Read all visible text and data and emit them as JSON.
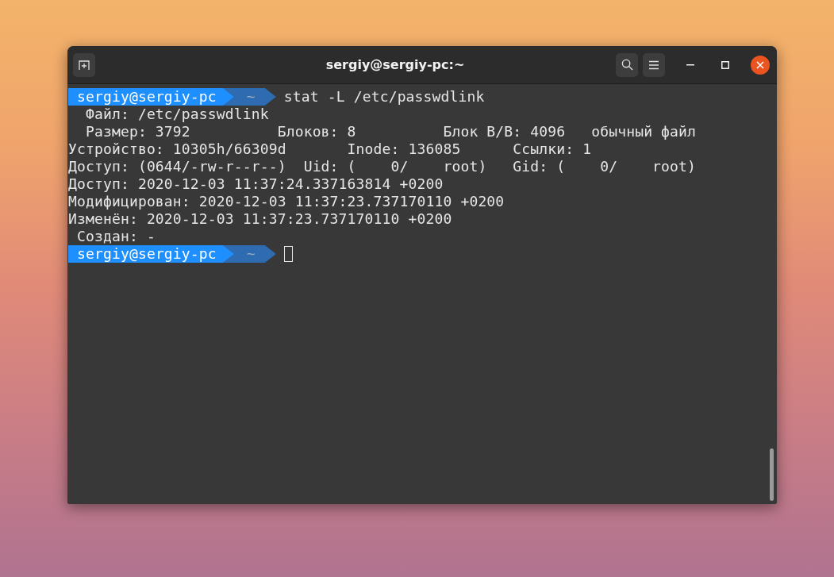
{
  "window": {
    "title": "sergiy@sergiy-pc:~"
  },
  "terminal": {
    "lines": [
      {
        "kind": "prompt",
        "user": "sergiy@sergiy-pc",
        "dir": "~",
        "command": "stat -L /etc/passwdlink"
      },
      {
        "kind": "output",
        "text": "  Файл: /etc/passwdlink"
      },
      {
        "kind": "output",
        "text": "  Размер: 3792      \tБлоков: 8          Блок В/В: 4096   обычный файл"
      },
      {
        "kind": "output",
        "text": "Устройство: 10305h/66309d\tInode: 136085      Ссылки: 1"
      },
      {
        "kind": "output",
        "text": "Доступ: (0644/-rw-r--r--)  Uid: (    0/    root)   Gid: (    0/    root)"
      },
      {
        "kind": "output",
        "text": "Доступ: 2020-12-03 11:37:24.337163814 +0200"
      },
      {
        "kind": "output",
        "text": "Модифицирован: 2020-12-03 11:37:23.737170110 +0200"
      },
      {
        "kind": "output",
        "text": "Изменён: 2020-12-03 11:37:23.737170110 +0200"
      },
      {
        "kind": "output",
        "text": " Создан: -"
      },
      {
        "kind": "prompt",
        "user": "sergiy@sergiy-pc",
        "dir": "~",
        "cursor": true
      }
    ]
  }
}
